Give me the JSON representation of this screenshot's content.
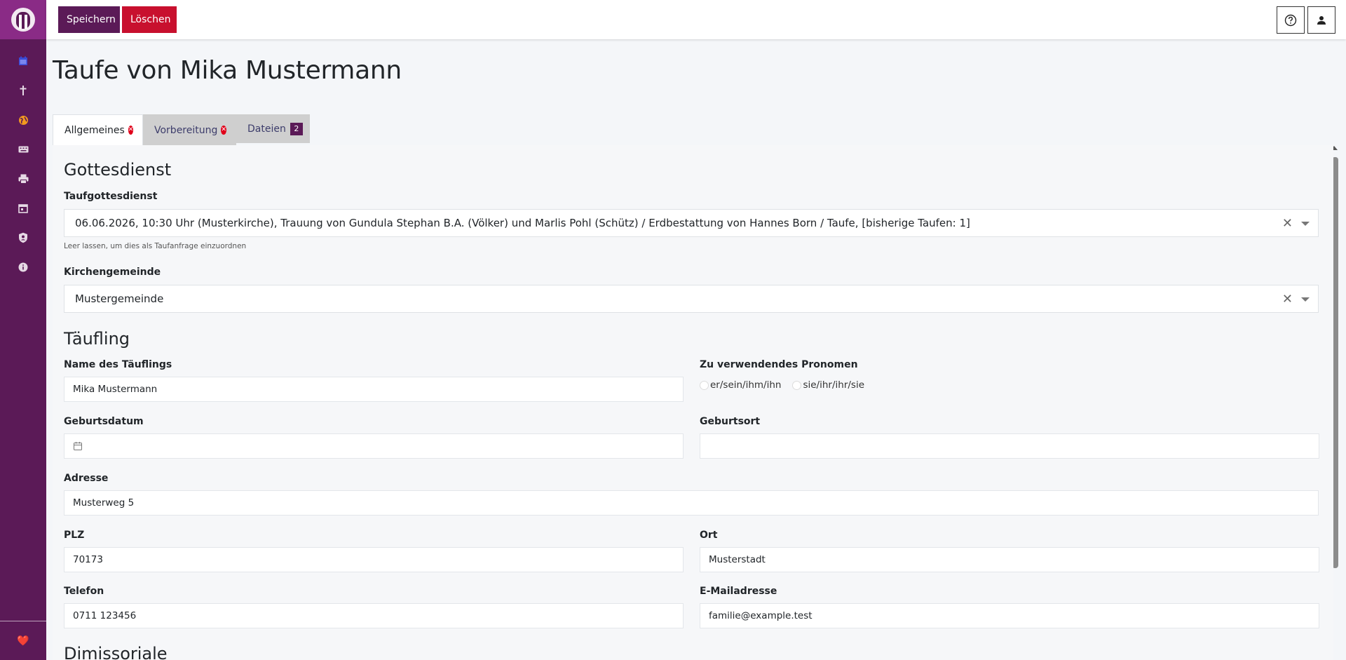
{
  "toolbar": {
    "save_label": "Speichern",
    "delete_label": "Löschen",
    "help_icon": "help-circle-icon",
    "user_icon": "user-icon"
  },
  "sidebar": {
    "items": [
      {
        "icon": "calendar-icon",
        "color": "#3a4bd6"
      },
      {
        "icon": "cross-icon",
        "color": "#e6d9e5"
      },
      {
        "icon": "globe-icon",
        "color": "#f29a1f"
      },
      {
        "icon": "keyboard-icon",
        "color": "#e6d9e5"
      },
      {
        "icon": "printer-icon",
        "color": "#e6d9e5"
      },
      {
        "icon": "calendar-month-icon",
        "color": "#e6d9e5"
      },
      {
        "icon": "shield-user-icon",
        "color": "#e6d9e5"
      },
      {
        "icon": "info-icon",
        "color": "#e6d9e5"
      }
    ],
    "footer_icon": "heart-icon",
    "footer_glyph": "❤️"
  },
  "page": {
    "title": "Taufe von Mika Mustermann"
  },
  "tabs": [
    {
      "label": "Allgemeines",
      "has_error": true
    },
    {
      "label": "Vorbereitung",
      "has_error": true
    },
    {
      "label": "Dateien",
      "badge": "2"
    }
  ],
  "sections": {
    "gottesdienst": "Gottesdienst",
    "taeufling": "Täufling",
    "dimissoriale": "Dimissoriale"
  },
  "fields": {
    "taufgottesdienst": {
      "label": "Taufgottesdienst",
      "value": "06.06.2026, 10:30 Uhr (Musterkirche), Trauung von Gundula Stephan B.A. (Völker) und Marlis Pohl (Schütz) / Erdbestattung von Hannes Born / Taufe, [bisherige Taufen: 1]",
      "help": "Leer lassen, um dies als Taufanfrage einzuordnen"
    },
    "kirchengemeinde": {
      "label": "Kirchengemeinde",
      "value": "Mustergemeinde"
    },
    "name": {
      "label": "Name des Täuflings",
      "value": "Mika Mustermann"
    },
    "pronomen": {
      "label": "Zu verwendendes Pronomen",
      "options": [
        "er/sein/ihm/ihn",
        "sie/ihr/ihr/sie"
      ]
    },
    "geburtsdatum": {
      "label": "Geburtsdatum",
      "value": ""
    },
    "geburtsort": {
      "label": "Geburtsort",
      "value": ""
    },
    "adresse": {
      "label": "Adresse",
      "value": "Musterweg 5"
    },
    "plz": {
      "label": "PLZ",
      "value": "70173"
    },
    "ort": {
      "label": "Ort",
      "value": "Musterstadt"
    },
    "telefon": {
      "label": "Telefon",
      "value": "0711 123456"
    },
    "email": {
      "label": "E-Mailadresse",
      "value": "familie@example.test"
    }
  },
  "colors": {
    "brand": "#5b1a57",
    "brand_light": "#8a2b86",
    "danger": "#c8102e"
  }
}
